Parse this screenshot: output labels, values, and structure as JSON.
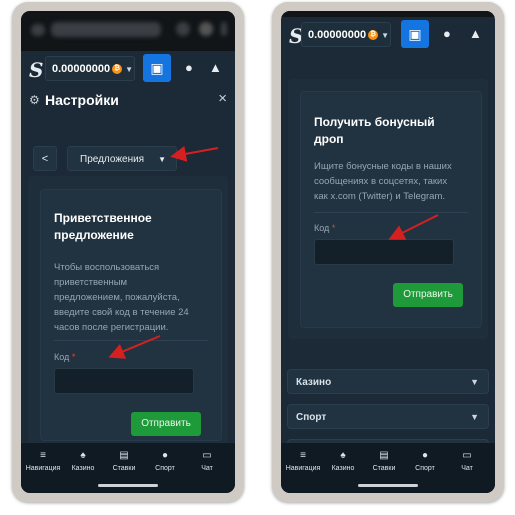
{
  "left_screen": {
    "balance": "0.00000000",
    "coin_symbol": "₿",
    "settings_title": "Настройки",
    "back_label": "<",
    "dropdown_label": "Предложения",
    "card": {
      "title_line1": "Приветственное",
      "title_line2": "предложение",
      "desc": [
        "Чтобы воспользоваться",
        "приветственным",
        "предложением, пожалуйста,",
        "введите свой код в течение 24",
        "часов после регистрации."
      ],
      "code_label": "Код",
      "required_mark": "*",
      "submit_label": "Отправить"
    },
    "bottom_nav": [
      {
        "icon": "≡",
        "label": "Навигация"
      },
      {
        "icon": "♠",
        "label": "Казино"
      },
      {
        "icon": "▤",
        "label": "Ставки"
      },
      {
        "icon": "●",
        "label": "Спорт"
      },
      {
        "icon": "▭",
        "label": "Чат"
      }
    ]
  },
  "right_screen": {
    "balance": "0.00000000",
    "coin_symbol": "₿",
    "card": {
      "title_line1": "Получить бонусный",
      "title_line2": "дроп",
      "desc": [
        "Ищите бонусные коды в наших",
        "сообщениях в соцсетях, таких",
        "как x.com (Twitter) и Telegram."
      ],
      "code_label": "Код",
      "required_mark": "*",
      "submit_label": "Отправить"
    },
    "accordions": [
      {
        "label": "Казино"
      },
      {
        "label": "Спорт"
      }
    ],
    "bottom_nav": [
      {
        "icon": "≡",
        "label": "Навигация"
      },
      {
        "icon": "♠",
        "label": "Казино"
      },
      {
        "icon": "▤",
        "label": "Ставки"
      },
      {
        "icon": "●",
        "label": "Спорт"
      },
      {
        "icon": "▭",
        "label": "Чат"
      }
    ]
  },
  "colors": {
    "accent_blue": "#1475e1",
    "submit_green": "#1f9a3a",
    "annotation_red": "#d62020",
    "background_dark": "#1b2a36"
  }
}
